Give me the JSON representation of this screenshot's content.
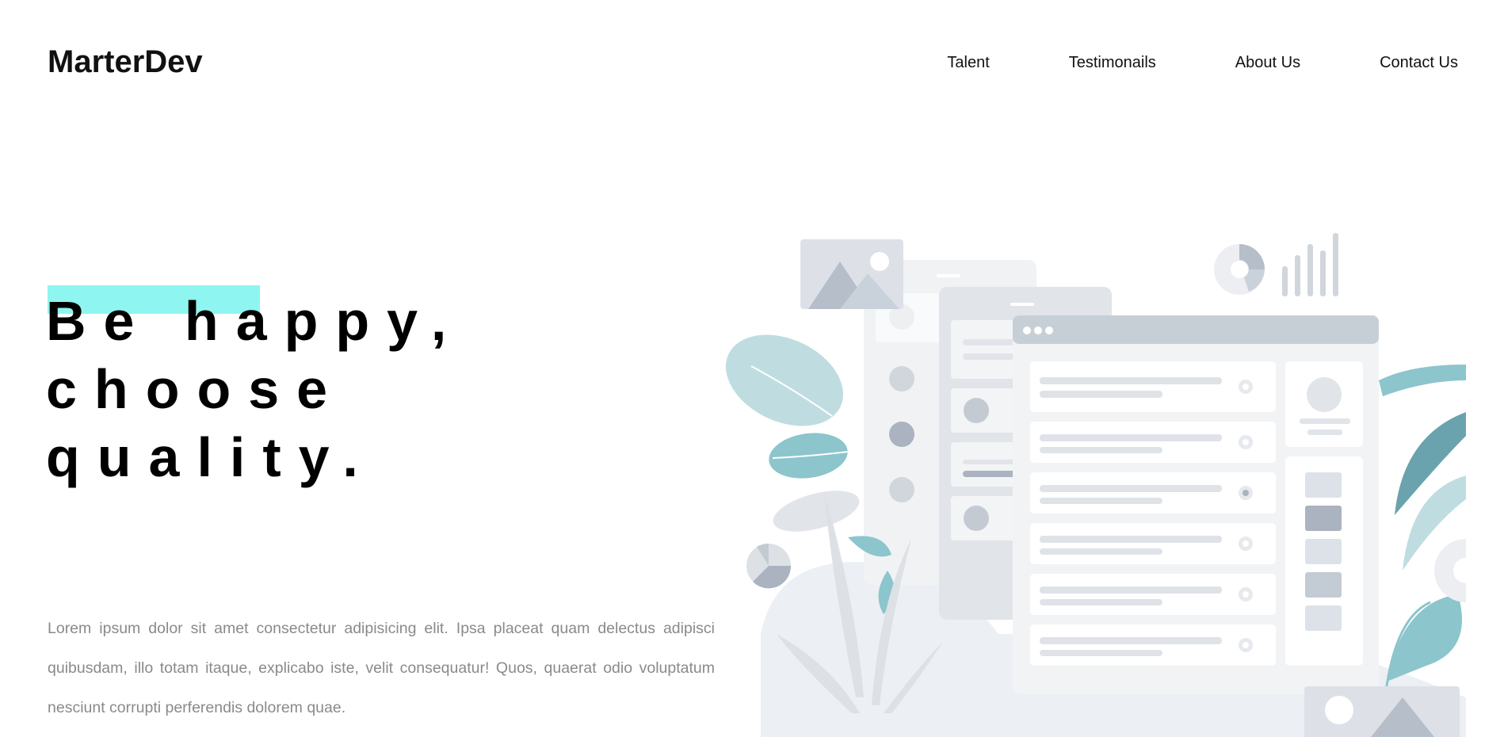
{
  "header": {
    "brand": "MarterDev",
    "nav": [
      {
        "label": "Talent"
      },
      {
        "label": "Testimonails"
      },
      {
        "label": "About Us"
      },
      {
        "label": "Contact Us"
      }
    ]
  },
  "hero": {
    "headline_lines": [
      "Be happy,",
      "choose",
      "quality."
    ],
    "body": "Lorem ipsum dolor sit amet consectetur adipisicing elit. Ipsa placeat quam delectus adipisci quibusdam, illo totam itaque, explicabo iste, velit consequatur! Quos, quaerat odio voluptatum nesciunt corrupti perferendis dolorem quae."
  },
  "colors": {
    "accent_highlight": "#8ff5f1",
    "text_dark": "#111111",
    "text_muted": "#8a8a8a",
    "teal": "#8cc5cc",
    "teal_dark": "#6aa3ad",
    "ui_gray": "#dde2e8"
  },
  "illustration": {
    "icon": "dashboard-illustration"
  }
}
